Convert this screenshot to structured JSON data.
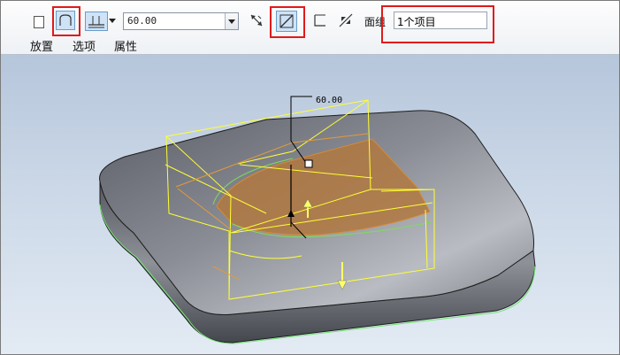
{
  "toolbar": {
    "depth_value": "60.00",
    "surface_group_label": "面组",
    "surface_group_value": "1个项目"
  },
  "tabs": [
    {
      "label": "放置"
    },
    {
      "label": "选项"
    },
    {
      "label": "属性"
    }
  ],
  "viewport": {
    "dimension_label": "60.00"
  },
  "colors": {
    "highlight_box": "#e01a1a",
    "preview_wire": "#ffff33",
    "cut_surface": "#b07840",
    "model": "#6e7178"
  }
}
